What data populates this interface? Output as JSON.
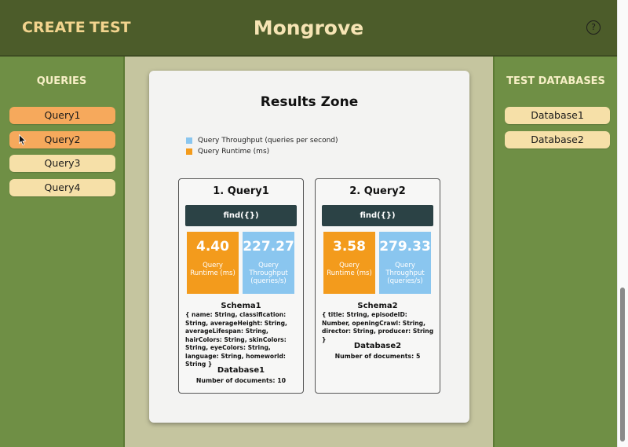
{
  "header": {
    "nav": [
      "CREATE",
      "TEST"
    ],
    "title": "Mongrove",
    "help_icon": "?"
  },
  "left_sidebar": {
    "heading": "QUERIES",
    "items": [
      "Query1",
      "Query2",
      "Query3",
      "Query4"
    ],
    "active_items": [
      "Query1",
      "Query2"
    ]
  },
  "right_sidebar": {
    "heading": "TEST DATABASES",
    "items": [
      "Database1",
      "Database2"
    ]
  },
  "results": {
    "title": "Results Zone",
    "legend": [
      {
        "label": "Query Throughput (queries per second)",
        "color": "#8ac6ef"
      },
      {
        "label": "Query Runtime (ms)",
        "color": "#f39b1c"
      }
    ],
    "queries": [
      {
        "title": "1. Query1",
        "code": "find({})",
        "runtime_value": "4.40",
        "runtime_label": "Query Runtime (ms)",
        "throughput_value": "227.27",
        "throughput_label": "Query Throughput (queries/s)",
        "schema_name": "Schema1",
        "schema_text": "{ name: String, classification: String, averageHeight: String, averageLifespan: String, hairColors: String, skinColors: String, eyeColors: String, language: String, homeworld: String }",
        "database": "Database1",
        "doc_count": "Number of documents: 10"
      },
      {
        "title": "2. Query2",
        "code": "find({})",
        "runtime_value": "3.58",
        "runtime_label": "Query Runtime (ms)",
        "throughput_value": "279.33",
        "throughput_label": "Query Throughput (queries/s)",
        "schema_name": "Schema2",
        "schema_text": "{ title: String, episodeID: Number, openingCrawl: String, director: String, producer: String }",
        "database": "Database2",
        "doc_count": "Number of documents: 5"
      }
    ]
  },
  "colors": {
    "header_bg": "#4c5c2a",
    "sidebar_bg": "#6f8f45",
    "center_bg": "#c5c59f",
    "pill_bg": "#f6e0a8",
    "pill_active": "#f6a95c",
    "runtime": "#f39b1c",
    "throughput": "#8ac6ef",
    "code_bg": "#2b4245"
  }
}
